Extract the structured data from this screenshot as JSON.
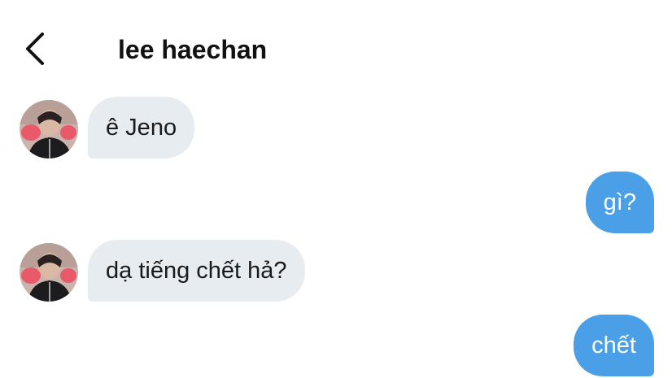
{
  "header": {
    "back_icon": "chevron-left-icon",
    "title": "lee haechan"
  },
  "colors": {
    "incoming_bubble": "#e7ecf1",
    "outgoing_bubble": "#4a9fe6",
    "outgoing_text": "#ffffff"
  },
  "messages": [
    {
      "sender": "them",
      "text": "ê Jeno"
    },
    {
      "sender": "me",
      "text": "gì?"
    },
    {
      "sender": "them",
      "text": "dạ tiếng chết hả?"
    },
    {
      "sender": "me",
      "text": "chết"
    }
  ]
}
